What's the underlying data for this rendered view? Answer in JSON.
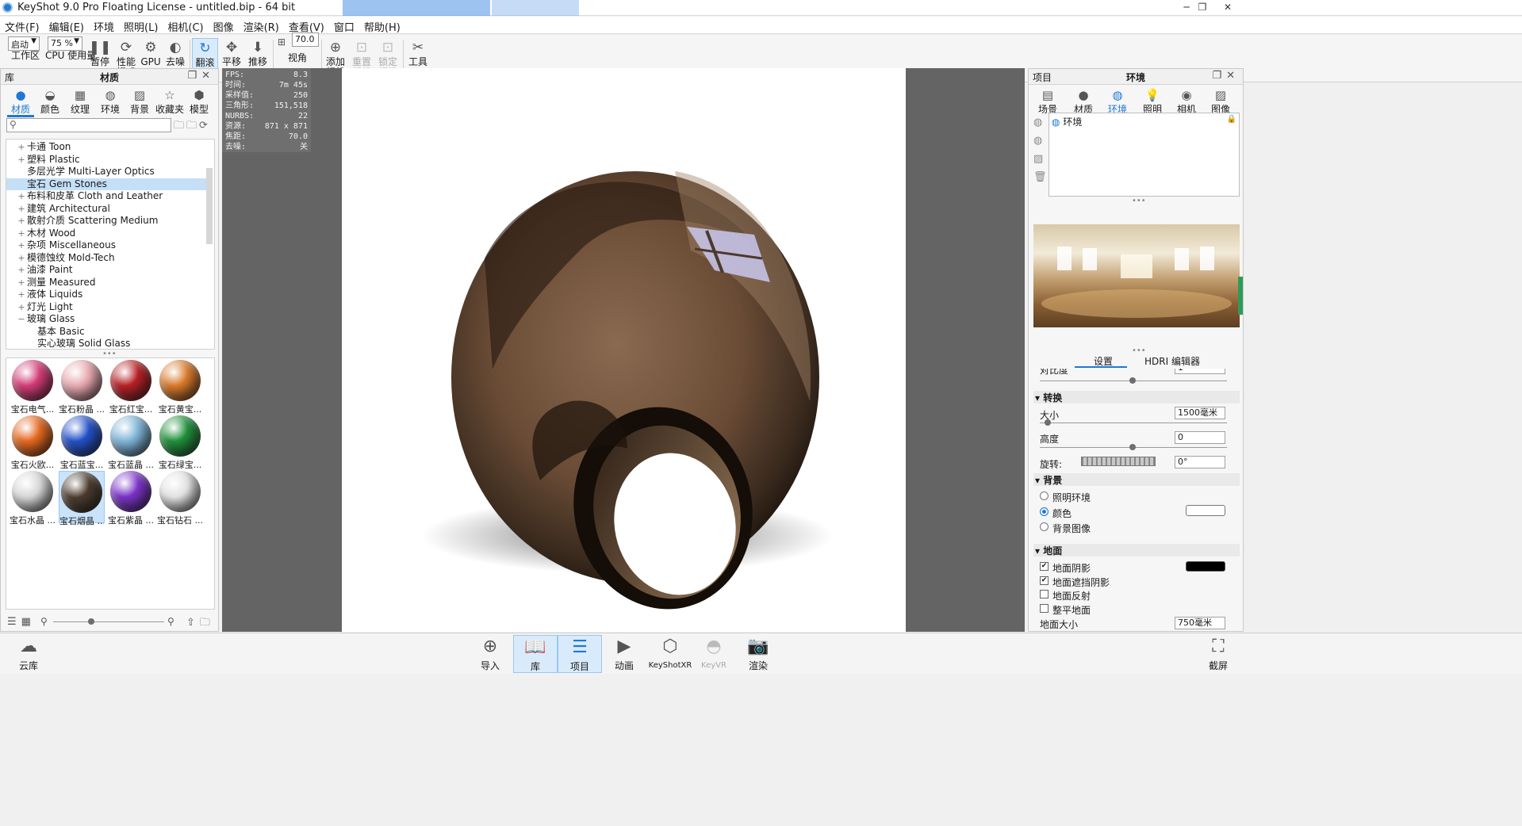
{
  "window": {
    "title": "KeyShot 9.0 Pro Floating License  - untitled.bip  - 64 bit",
    "controls": {
      "minimize": "─",
      "restore": "❐",
      "close": "✕"
    }
  },
  "menu": [
    "文件(F)",
    "编辑(E)",
    "环境",
    "照明(L)",
    "相机(C)",
    "图像",
    "渲染(R)",
    "查看(V)",
    "窗口",
    "帮助(H)"
  ],
  "toolbar": {
    "workspace_select": "启动",
    "workspace_label": "工作区",
    "cpu_select": "75 %",
    "cpu_label": "CPU 使用量",
    "pause": "暂停",
    "performance_line1": "性能",
    "performance_line2": "模式",
    "gpu": "GPU",
    "denoise": "去噪",
    "tumble": "翻滚",
    "pan": "平移",
    "dolly": "推移",
    "fov_value": "70.0",
    "fov_label": "视角",
    "add_camera_1": "添加",
    "add_camera_2": "相机",
    "reset_camera_1": "重置",
    "reset_camera_2": "相机",
    "lock_camera_1": "锁定",
    "lock_camera_2": "相机",
    "tools": "工具"
  },
  "library": {
    "panel_label": "库",
    "panel_title": "材质",
    "tabs": [
      "材质",
      "颜色",
      "纹理",
      "环境",
      "背景",
      "收藏夹",
      "模型"
    ],
    "search_placeholder": "",
    "tree": [
      {
        "label": "卡通 Toon",
        "exp": "+",
        "indent": 0,
        "selected": false
      },
      {
        "label": "塑料 Plastic",
        "exp": "+",
        "indent": 0,
        "selected": false
      },
      {
        "label": "多层光学 Multi-Layer Optics",
        "exp": "",
        "indent": 0,
        "selected": false
      },
      {
        "label": "宝石 Gem Stones",
        "exp": "",
        "indent": 0,
        "selected": true
      },
      {
        "label": "布料和皮革 Cloth and Leather",
        "exp": "+",
        "indent": 0,
        "selected": false
      },
      {
        "label": "建筑 Architectural",
        "exp": "+",
        "indent": 0,
        "selected": false
      },
      {
        "label": "散射介质 Scattering Medium",
        "exp": "+",
        "indent": 0,
        "selected": false
      },
      {
        "label": "木材 Wood",
        "exp": "+",
        "indent": 0,
        "selected": false
      },
      {
        "label": "杂项 Miscellaneous",
        "exp": "+",
        "indent": 0,
        "selected": false
      },
      {
        "label": "模德蚀纹 Mold-Tech",
        "exp": "+",
        "indent": 0,
        "selected": false
      },
      {
        "label": "油漆 Paint",
        "exp": "+",
        "indent": 0,
        "selected": false
      },
      {
        "label": "测量 Measured",
        "exp": "+",
        "indent": 0,
        "selected": false
      },
      {
        "label": "液体 Liquids",
        "exp": "+",
        "indent": 0,
        "selected": false
      },
      {
        "label": "灯光 Light",
        "exp": "+",
        "indent": 0,
        "selected": false
      },
      {
        "label": "玻璃 Glass",
        "exp": "−",
        "indent": 0,
        "selected": false
      },
      {
        "label": "基本 Basic",
        "exp": "",
        "indent": 1,
        "selected": false
      },
      {
        "label": "实心玻璃 Solid Glass",
        "exp": "",
        "indent": 1,
        "selected": false
      }
    ],
    "thumbnails": [
      {
        "caption": "宝石电气...",
        "color": "#d23a74",
        "selected": false
      },
      {
        "caption": "宝石粉晶 ...",
        "color": "#e7a8b0",
        "selected": false
      },
      {
        "caption": "宝石红宝...",
        "color": "#b51f24",
        "selected": false
      },
      {
        "caption": "宝石黄宝...",
        "color": "#d9782a",
        "selected": false
      },
      {
        "caption": "宝石火欧...",
        "color": "#e4661e",
        "selected": false
      },
      {
        "caption": "宝石蓝宝...",
        "color": "#2250c8",
        "selected": false
      },
      {
        "caption": "宝石蓝晶 ...",
        "color": "#7eb4d8",
        "selected": false
      },
      {
        "caption": "宝石绿宝...",
        "color": "#1f8f3a",
        "selected": false
      },
      {
        "caption": "宝石水晶 ...",
        "color": "#d7d7d7",
        "selected": false
      },
      {
        "caption": "宝石烟晶 ...",
        "color": "#4a3a2e",
        "selected": true
      },
      {
        "caption": "宝石紫晶 ...",
        "color": "#7a32c8",
        "selected": false
      },
      {
        "caption": "宝石钻石 ...",
        "color": "#e2e2e2",
        "selected": false
      }
    ]
  },
  "hud": [
    {
      "k": "FPS:",
      "v": "8.3"
    },
    {
      "k": "时间:",
      "v": "7m 45s"
    },
    {
      "k": "采样值:",
      "v": "250"
    },
    {
      "k": "三角形:",
      "v": "151,518"
    },
    {
      "k": "NURBS:",
      "v": "22"
    },
    {
      "k": "资源:",
      "v": "871 x 871"
    },
    {
      "k": "焦距:",
      "v": "70.0"
    },
    {
      "k": "去噪:",
      "v": "关"
    }
  ],
  "project": {
    "panel_label": "项目",
    "panel_title": "环境",
    "tabs": [
      "场景",
      "材质",
      "环境",
      "照明",
      "相机",
      "图像"
    ],
    "env_list_item": "环境",
    "subtabs": [
      "设置",
      "HDRI 编辑器"
    ],
    "contrast_label": "对比度",
    "contrast_value": "1",
    "transform_section": "转换",
    "size_label": "大小",
    "size_value": "1500毫米",
    "height_label": "高度",
    "height_value": "0",
    "rotation_label": "旋转:",
    "rotation_value": "0°",
    "background_section": "背景",
    "bg_options": [
      {
        "label": "照明环境",
        "on": false
      },
      {
        "label": "颜色",
        "on": true
      },
      {
        "label": "背景图像",
        "on": false
      }
    ],
    "bg_color": "#ffffff",
    "ground_section": "地面",
    "ground_options": [
      {
        "label": "地面阴影",
        "on": true
      },
      {
        "label": "地面遮挡阴影",
        "on": true
      },
      {
        "label": "地面反射",
        "on": false
      },
      {
        "label": "整平地面",
        "on": false
      }
    ],
    "ground_shadow_color": "#000000",
    "ground_size_label": "地面大小",
    "ground_size_value": "750毫米"
  },
  "bottom": {
    "cloud": "云库",
    "import": "导入",
    "library": "库",
    "project": "项目",
    "animation": "动画",
    "keyshotxr": "KeyShotXR",
    "keyvr": "KeyVR",
    "render": "渲染",
    "screenshot": "截屏"
  }
}
